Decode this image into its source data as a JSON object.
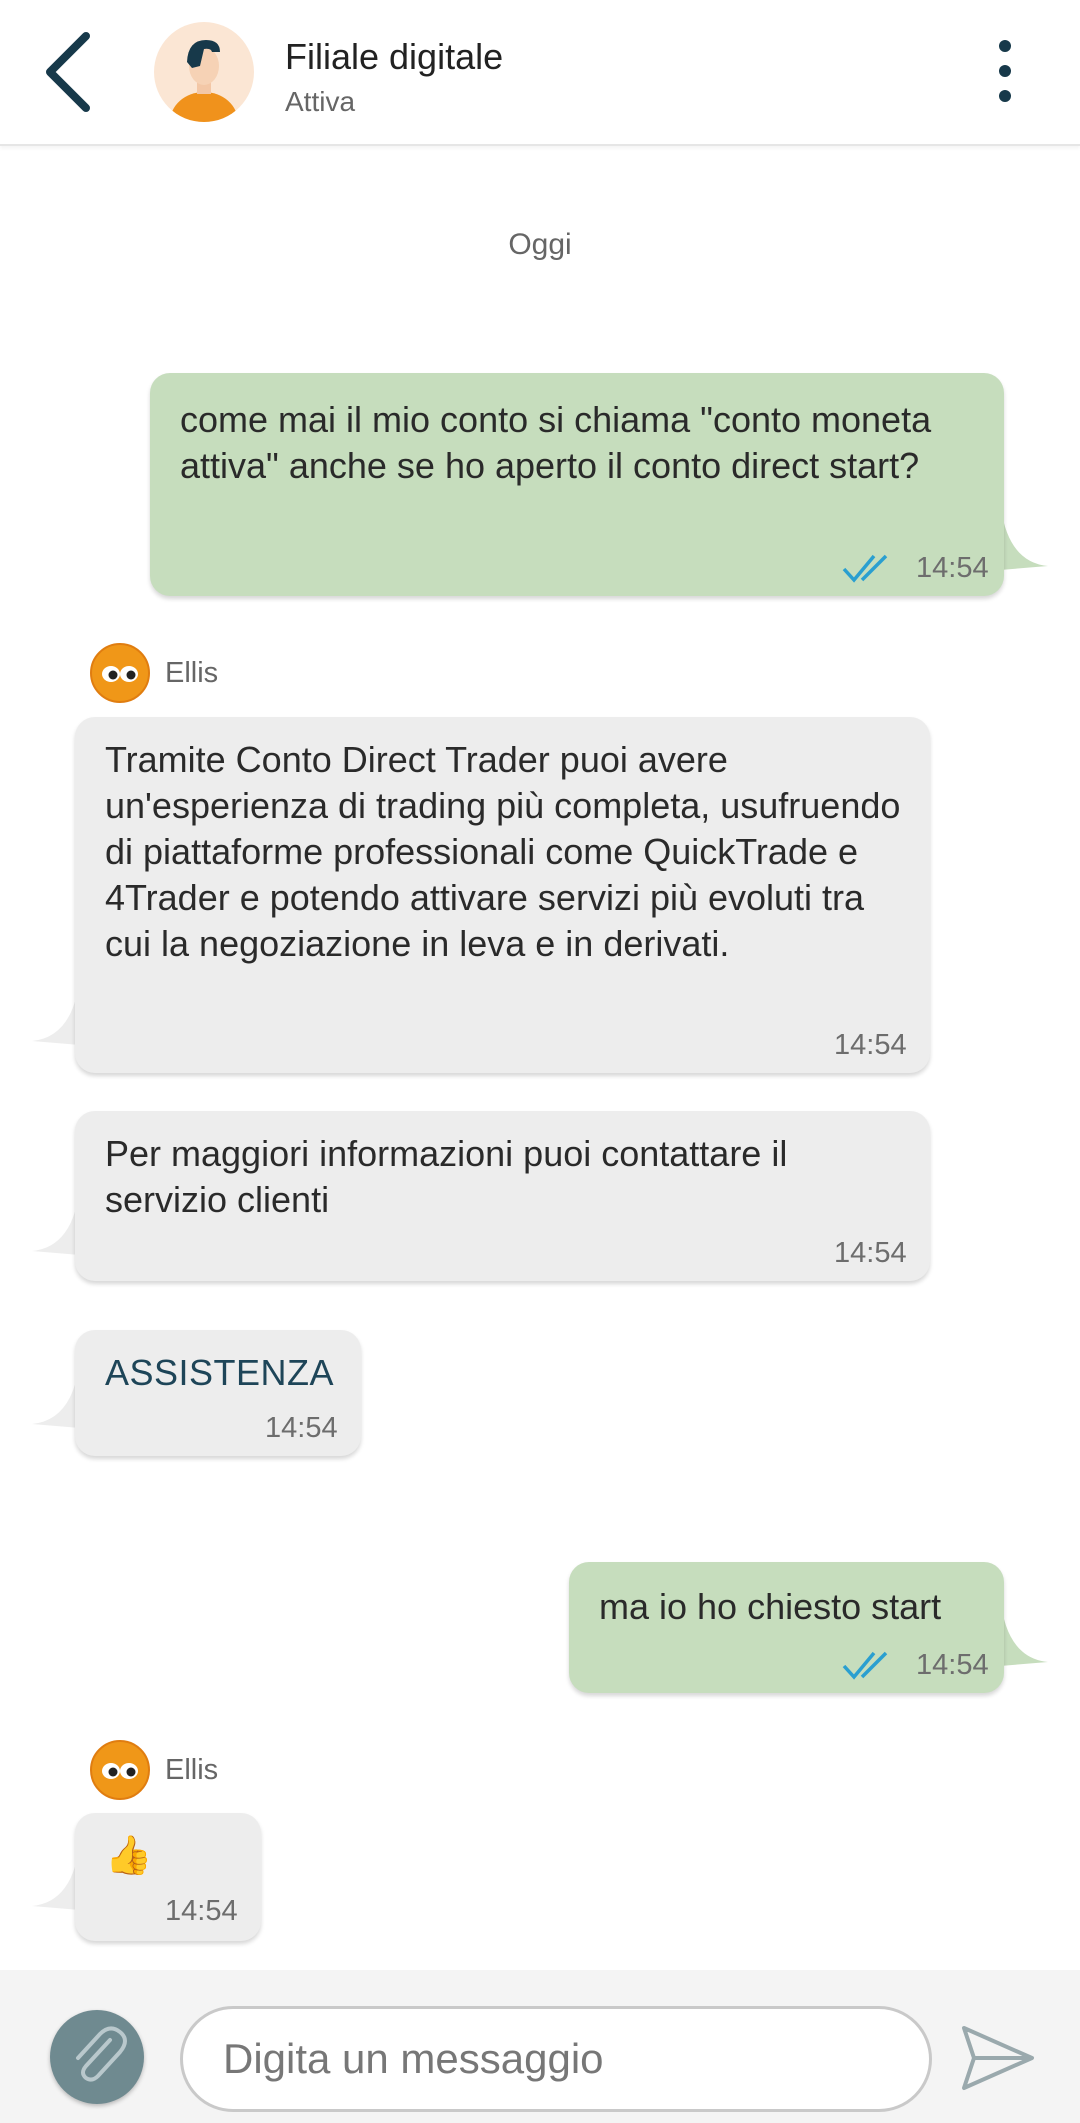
{
  "header": {
    "title": "Filiale digitale",
    "status": "Attiva"
  },
  "chat": {
    "day_divider": "Oggi",
    "messages": [
      {
        "text": "come mai il mio conto si chiama \"conto moneta attiva\" anche se ho aperto il conto direct start?",
        "time": "14:54"
      },
      {
        "sender": "Ellis",
        "text": "Tramite Conto Direct Trader puoi avere un'esperienza di trading più completa, usufruendo di piattaforme professionali come QuickTrade e 4Trader e potendo attivare servizi più evoluti tra cui la negoziazione in leva e in derivati.",
        "time": "14:54"
      },
      {
        "text": "Per maggiori informazioni puoi contattare il servizio clienti",
        "time": "14:54"
      },
      {
        "text": "ASSISTENZA",
        "time": "14:54"
      },
      {
        "text": "ma io ho chiesto start",
        "time": "14:54"
      },
      {
        "sender": "Ellis",
        "text": "👍",
        "time": "14:54"
      }
    ]
  },
  "composer": {
    "placeholder": "Digita un messaggio"
  },
  "colors": {
    "outgoing_bubble": "#c6ddbd",
    "incoming_bubble": "#ededed",
    "read_ticks": "#2a9fd0",
    "accent": "#17394a"
  },
  "icons": [
    "back-arrow-icon",
    "more-vertical-icon",
    "double-check-icon",
    "paperclip-icon",
    "send-icon"
  ]
}
